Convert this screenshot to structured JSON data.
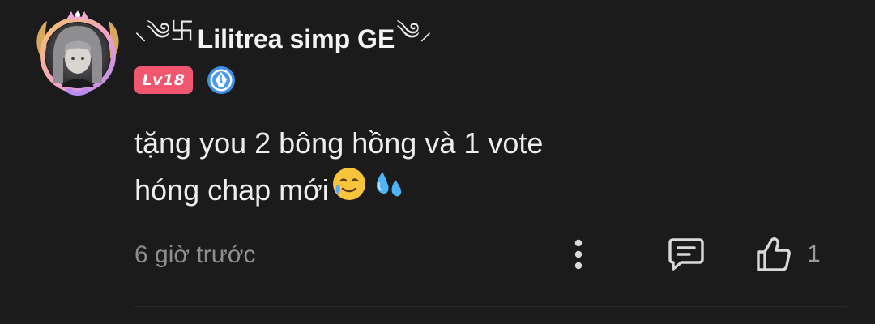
{
  "comment": {
    "author": {
      "name": "Lilitrea simp GE",
      "name_decoration_left": "⸜༄卐",
      "name_decoration_right": "༄⸝",
      "level_label": "Lv18",
      "avatar_icon": "anime-girl-avatar-with-crown-frame",
      "badge_icon": "pen-nib-badge-icon"
    },
    "text_lines": [
      "tặng you 2 bông hồng và 1 vote",
      "hóng chap mới"
    ],
    "emojis": [
      "smiling-face-with-tear",
      "sweat-droplets"
    ],
    "timestamp": "6 giờ trước",
    "like_count": "1"
  },
  "colors": {
    "background": "#1b1b1c",
    "level_badge": "#f1566f",
    "muted_text": "#8d8d8f",
    "icon": "#d9d9d9"
  }
}
